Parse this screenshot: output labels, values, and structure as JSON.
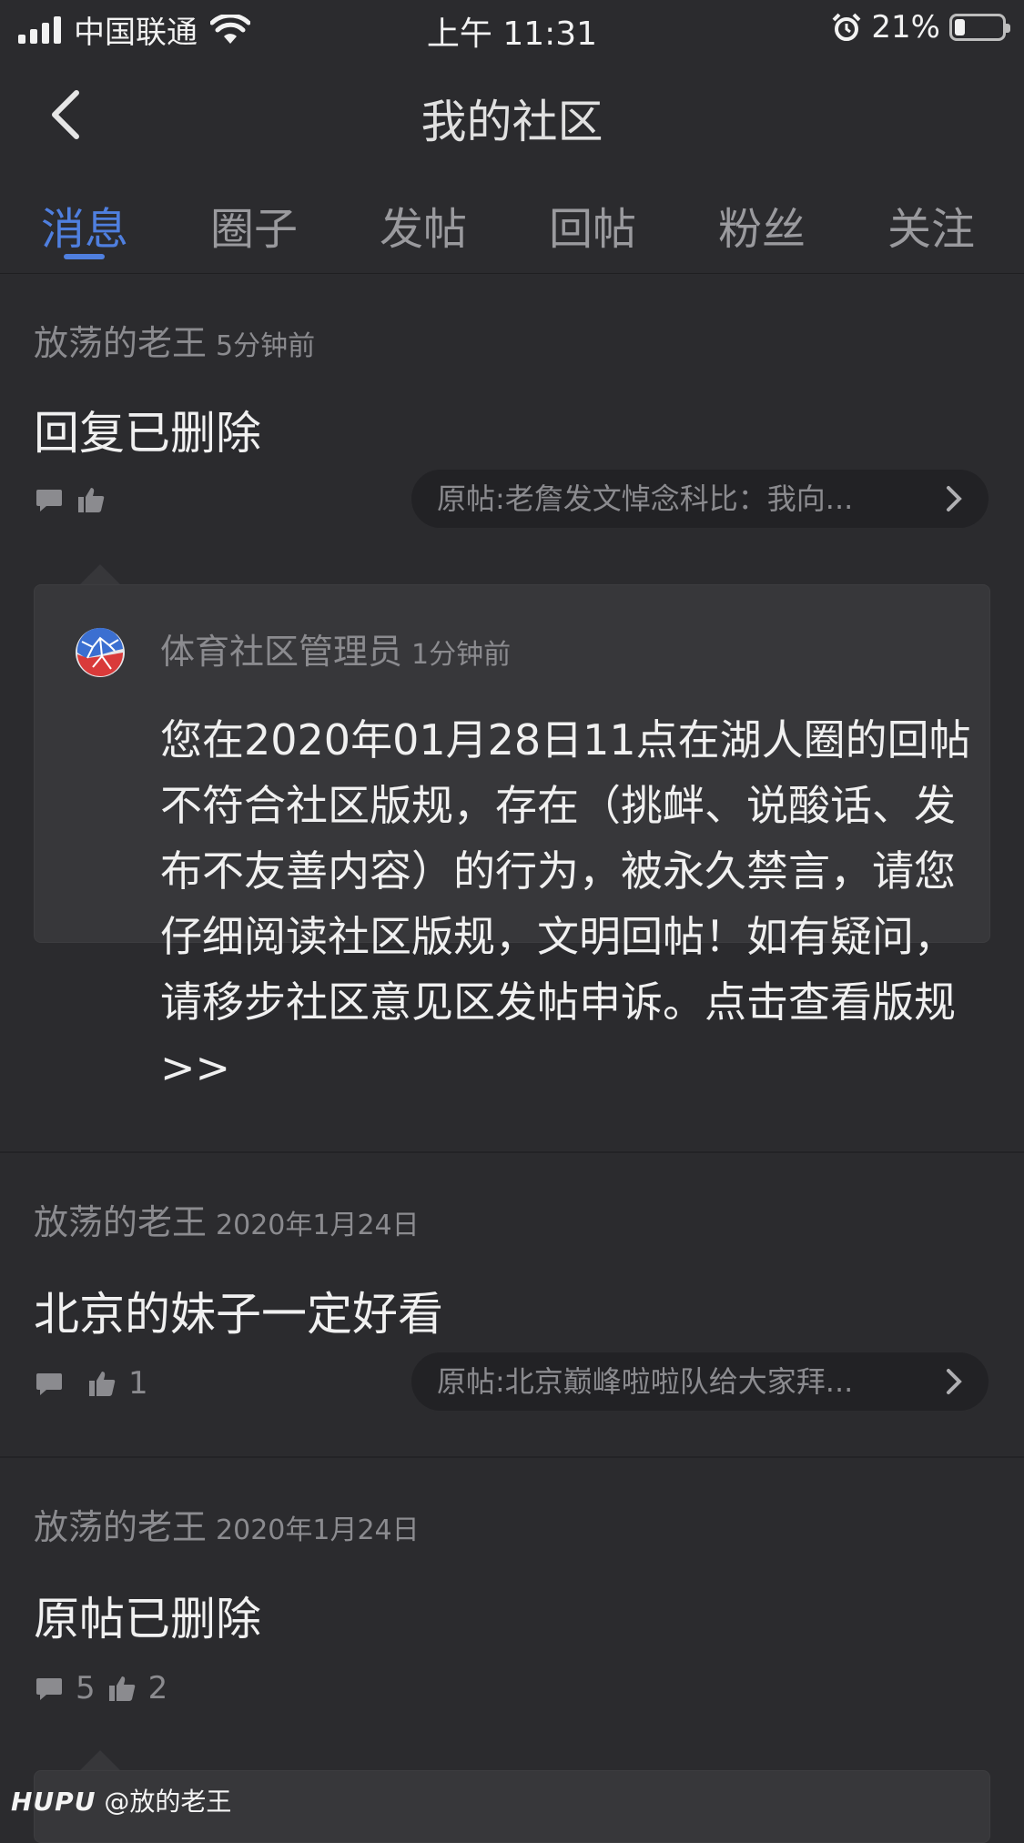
{
  "status_bar": {
    "carrier": "中国联通",
    "time": "上午 11:31",
    "battery": "21%",
    "battery_level": 0.21
  },
  "nav": {
    "title": "我的社区",
    "back_icon": "chevron-left-icon"
  },
  "tabs": [
    {
      "label": "消息",
      "active": true
    },
    {
      "label": "圈子",
      "active": false
    },
    {
      "label": "发帖",
      "active": false
    },
    {
      "label": "回帖",
      "active": false
    },
    {
      "label": "粉丝",
      "active": false
    },
    {
      "label": "关注",
      "active": false
    }
  ],
  "colors": {
    "accent": "#4f7fdf",
    "background": "#2b2b2e",
    "card": "#37373a"
  },
  "messages": [
    {
      "author": "放荡的老王",
      "time": "5分钟前",
      "content": "回复已删除",
      "comments": "",
      "likes": "",
      "original": "原帖:老詹发文悼念科比：我向...",
      "admin_reply": {
        "name": "体育社区管理员",
        "time": "1分钟前",
        "text": "您在2020年01月28日11点在湖人圈的回帖不符合社区版规，存在（挑衅、说酸话、发布不友善内容）的行为，被永久禁言，请您仔细阅读社区版规，文明回帖！如有疑问，请移步社区意见区发帖申诉。点击查看版规>>"
      }
    },
    {
      "author": "放荡的老王",
      "time": "2020年1月24日",
      "content": "北京的妹子一定好看",
      "comments": "",
      "likes": "1",
      "original": "原帖:北京巅峰啦啦队给大家拜..."
    },
    {
      "author": "放荡的老王",
      "time": "2020年1月24日",
      "content": "原帖已删除",
      "comments": "5",
      "likes": "2"
    }
  ],
  "watermark": {
    "brand": "HUPU",
    "handle": "@放的老王"
  }
}
